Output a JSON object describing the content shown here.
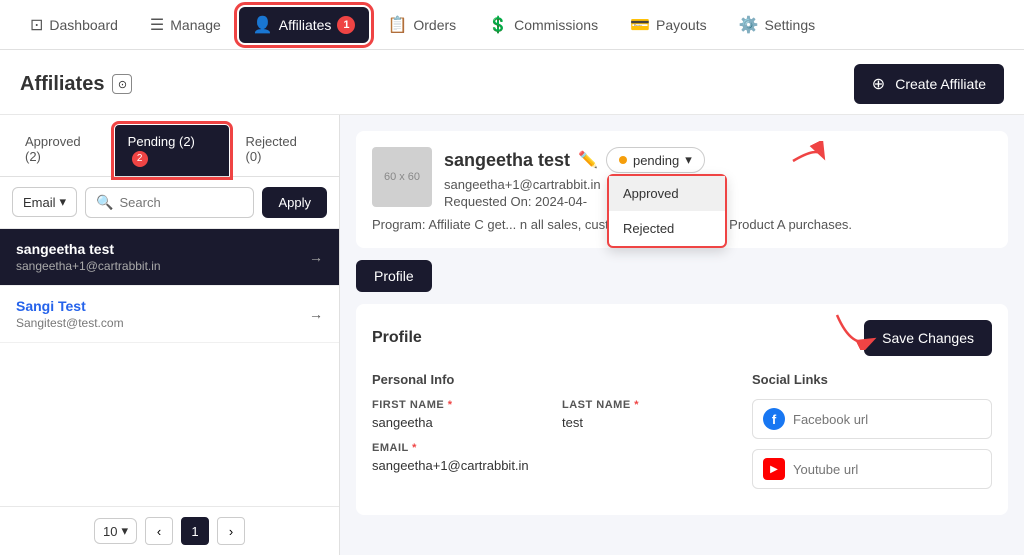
{
  "nav": {
    "items": [
      {
        "id": "dashboard",
        "label": "Dashboard",
        "icon": "dashboard-icon",
        "active": false,
        "badge": null
      },
      {
        "id": "manage",
        "label": "Manage",
        "icon": "manage-icon",
        "active": false,
        "badge": null
      },
      {
        "id": "affiliates",
        "label": "Affiliates",
        "icon": "affiliates-icon",
        "active": true,
        "badge": "1"
      },
      {
        "id": "orders",
        "label": "Orders",
        "icon": "orders-icon",
        "active": false,
        "badge": null
      },
      {
        "id": "commissions",
        "label": "Commissions",
        "icon": "commissions-icon",
        "active": false,
        "badge": null
      },
      {
        "id": "payouts",
        "label": "Payouts",
        "icon": "payouts-icon",
        "active": false,
        "badge": null
      },
      {
        "id": "settings",
        "label": "Settings",
        "icon": "settings-icon",
        "active": false,
        "badge": null
      }
    ]
  },
  "page": {
    "title": "Affiliates",
    "create_button": "Create Affiliate"
  },
  "sidebar": {
    "tabs": [
      {
        "id": "approved",
        "label": "Approved (2)",
        "active": false
      },
      {
        "id": "pending",
        "label": "Pending (2)",
        "active": true,
        "badge": "2"
      },
      {
        "id": "rejected",
        "label": "Rejected (0)",
        "active": false
      }
    ],
    "filter": {
      "select_label": "Email",
      "search_placeholder": "Search",
      "apply_label": "Apply"
    },
    "affiliates": [
      {
        "id": 1,
        "name": "sangeetha test",
        "email": "sangeetha+1@cartrabbit.in",
        "selected": true
      },
      {
        "id": 2,
        "name": "Sangi Test",
        "email": "Sangitest@test.com",
        "selected": false
      }
    ],
    "pagination": {
      "per_page": "10",
      "current_page": "1"
    }
  },
  "detail": {
    "avatar_label": "60 x 60",
    "name": "sangeetha test",
    "status": "pending",
    "email": "sangeetha+1@cartrabbit.in",
    "requested_on": "Requested On: 2024-04-",
    "program": "Program: Affiliate C get... n all sales, customers get 5% off for Product A purchases.",
    "dropdown": {
      "items": [
        "Approved",
        "Rejected"
      ]
    },
    "tabs": [
      {
        "id": "profile",
        "label": "Profile",
        "active": true
      }
    ],
    "profile_section": {
      "title": "Profile",
      "save_button": "Save Changes",
      "personal_info_label": "Personal Info",
      "fields": {
        "first_name_label": "FIRST NAME",
        "first_name_value": "sangeetha",
        "last_name_label": "LAST NAME",
        "last_name_value": "test",
        "email_label": "EMAIL",
        "email_value": "sangeetha+1@cartrabbit.in"
      },
      "social_links_label": "Social Links",
      "social": {
        "facebook_placeholder": "Facebook url",
        "youtube_placeholder": "Youtube url"
      }
    }
  }
}
